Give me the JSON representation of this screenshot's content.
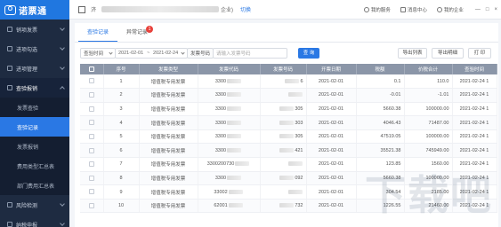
{
  "app": {
    "logo_mark": "O",
    "logo_text": "诺票通"
  },
  "sidebar": {
    "groups": [
      {
        "label": "销项发票",
        "open": false
      },
      {
        "label": "进项勾选",
        "open": false
      },
      {
        "label": "进项管理",
        "open": false
      },
      {
        "label": "查验报销",
        "open": true
      }
    ],
    "sub_items": [
      {
        "label": "发票查验",
        "active": false
      },
      {
        "label": "查验记录",
        "active": true
      },
      {
        "label": "发票报销",
        "active": false
      },
      {
        "label": "费用类型汇总表",
        "active": false
      },
      {
        "label": "部门费用汇总表",
        "active": false
      }
    ],
    "bottom_groups": [
      {
        "label": "风险检测"
      },
      {
        "label": "纳税申报"
      }
    ]
  },
  "topbar": {
    "company_prefix": "济",
    "company_suffix": "企业)",
    "switch_label": "切换",
    "service_label": "我的服务",
    "message_label": "消息中心",
    "enterprise_label": "我的企业",
    "win_minimize": "—",
    "win_maximize": "□",
    "win_close": "×"
  },
  "tabs": [
    {
      "label": "查验记录",
      "active": true,
      "badge": ""
    },
    {
      "label": "异常记录",
      "active": false,
      "badge": "1"
    }
  ],
  "filters": {
    "date_type": "查验时间",
    "date_start": "2021-02-01",
    "date_sep": "~",
    "date_end": "2021-02-24",
    "code_label": "发票号码",
    "code_placeholder": "请输入发票号码",
    "query_button": "查 询",
    "export_list": "导出列表",
    "export_detail": "导出明细",
    "print": "打 印"
  },
  "table": {
    "columns": [
      "",
      "序号",
      "发票类型",
      "发票代码",
      "发票号码",
      "开票日期",
      "税额",
      "价税合计",
      "查验时间"
    ],
    "rows": [
      {
        "no": "1",
        "type": "增值税专用发票",
        "code": "3300",
        "number": "6",
        "date": "2021-02-01",
        "tax": "0.1",
        "total": "110.0",
        "time": "2021-02-24 1"
      },
      {
        "no": "2",
        "type": "增值税专用发票",
        "code": "3300",
        "number": "",
        "date": "2021-02-01",
        "tax": "-0.01",
        "total": "-1.01",
        "time": "2021-02-24 1"
      },
      {
        "no": "3",
        "type": "增值税专用发票",
        "code": "3300",
        "number": "305",
        "date": "2021-02-01",
        "tax": "5660.38",
        "total": "100000.00",
        "time": "2021-02-24 1"
      },
      {
        "no": "4",
        "type": "增值税专用发票",
        "code": "3300",
        "number": "303",
        "date": "2021-02-01",
        "tax": "4046.43",
        "total": "71487.00",
        "time": "2021-02-24 1"
      },
      {
        "no": "5",
        "type": "增值税专用发票",
        "code": "3300",
        "number": "305",
        "date": "2021-02-01",
        "tax": "47519.05",
        "total": "100000.00",
        "time": "2021-02-24 1"
      },
      {
        "no": "6",
        "type": "增值税专用发票",
        "code": "3300",
        "number": "421",
        "date": "2021-02-01",
        "tax": "35521.38",
        "total": "745949.00",
        "time": "2021-02-24 1"
      },
      {
        "no": "7",
        "type": "增值税专用发票",
        "code": "3300200730",
        "number": "",
        "date": "2021-02-01",
        "tax": "123.85",
        "total": "1560.00",
        "time": "2021-02-24 1"
      },
      {
        "no": "8",
        "type": "增值税专用发票",
        "code": "3300",
        "number": "092",
        "date": "2021-02-01",
        "tax": "5660.38",
        "total": "100000.00",
        "time": "2021-02-24 1"
      },
      {
        "no": "9",
        "type": "增值税专用发票",
        "code": "33002",
        "number": "",
        "date": "2021-02-01",
        "tax": "304.54",
        "total": "2185.00",
        "time": "2021-02-24 1"
      },
      {
        "no": "10",
        "type": "增值税专用发票",
        "code": "62001",
        "number": "732",
        "date": "2021-02-01",
        "tax": "1226.55",
        "total": "21460.00",
        "time": "2021-02-24 1"
      }
    ]
  },
  "watermark": "下载吧"
}
